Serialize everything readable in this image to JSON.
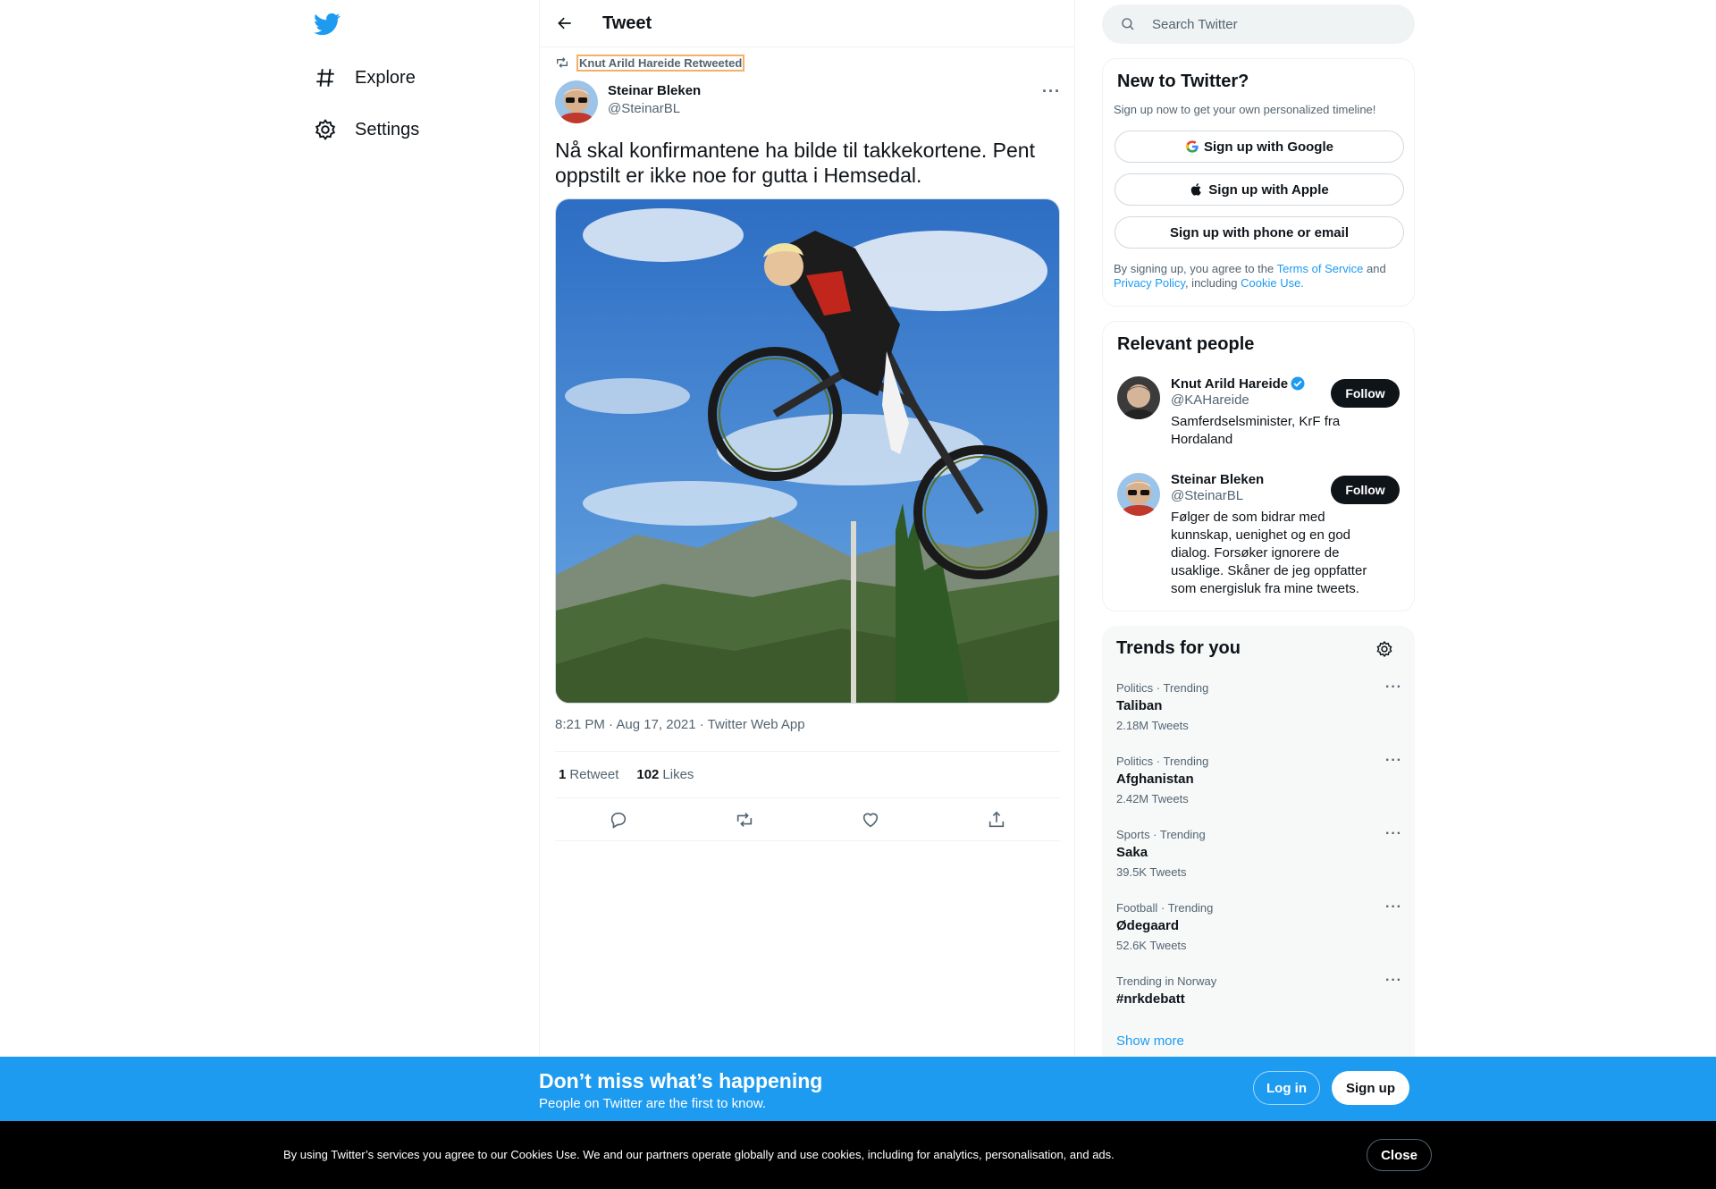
{
  "nav": {
    "logo": "twitter-bird-icon",
    "explore": "Explore",
    "settings": "Settings"
  },
  "header": {
    "title": "Tweet"
  },
  "tweet": {
    "retweeted_by": "Knut Arild Hareide Retweeted",
    "author_name": "Steinar Bleken",
    "author_handle": "@SteinarBL",
    "text": "Nå skal konfirmantene ha bilde til takkekortene. Pent oppstilt er ikke noe for gutta i Hemsedal.",
    "meta": "8:21 PM · Aug 17, 2021 · Twitter Web App",
    "retweet_count": "1",
    "retweet_label": "Retweet",
    "like_count": "102",
    "like_label": "Likes"
  },
  "search": {
    "placeholder": "Search Twitter"
  },
  "new_to_twitter": {
    "title": "New to Twitter?",
    "subtitle": "Sign up now to get your own personalized timeline!",
    "google": "Sign up with Google",
    "apple": "Sign up with Apple",
    "phone": "Sign up with phone or email",
    "legal_1": "By signing up, you agree to the ",
    "terms": "Terms of Service",
    "legal_2": " and ",
    "privacy": "Privacy Policy",
    "legal_3": ", including ",
    "cookie": "Cookie Use."
  },
  "relevant": {
    "title": "Relevant people",
    "people": [
      {
        "name": "Knut Arild Hareide",
        "handle": "@KAHareide",
        "bio": "Samferdselsminister, KrF fra Hordaland",
        "follow": "Follow",
        "verified": true
      },
      {
        "name": "Steinar Bleken",
        "handle": "@SteinarBL",
        "bio": "Følger de som bidrar med kunnskap, uenighet og en god dialog. Forsøker ignorere de usaklige. Skåner de jeg oppfatter som energisluk fra mine tweets.",
        "follow": "Follow",
        "verified": false
      }
    ]
  },
  "trends": {
    "title": "Trends for you",
    "items": [
      {
        "context": "Politics · Trending",
        "name": "Taliban",
        "count": "2.18M Tweets"
      },
      {
        "context": "Politics · Trending",
        "name": "Afghanistan",
        "count": "2.42M Tweets"
      },
      {
        "context": "Sports · Trending",
        "name": "Saka",
        "count": "39.5K Tweets"
      },
      {
        "context": "Football · Trending",
        "name": "Ødegaard",
        "count": "52.6K Tweets"
      },
      {
        "context": "Trending in Norway",
        "name": "#nrkdebatt",
        "count": ""
      }
    ],
    "show_more": "Show more"
  },
  "banner": {
    "title": "Don’t miss what’s happening",
    "subtitle": "People on Twitter are the first to know.",
    "login": "Log in",
    "signup": "Sign up"
  },
  "cookie_bar": {
    "text": "By using Twitter’s services you agree to our Cookies Use. We and our partners operate globally and use cookies, including for analytics, personalisation, and ads.",
    "close": "Close"
  },
  "colors": {
    "accent": "#1d9bf0",
    "text": "#0f1419",
    "muted": "#536471"
  }
}
